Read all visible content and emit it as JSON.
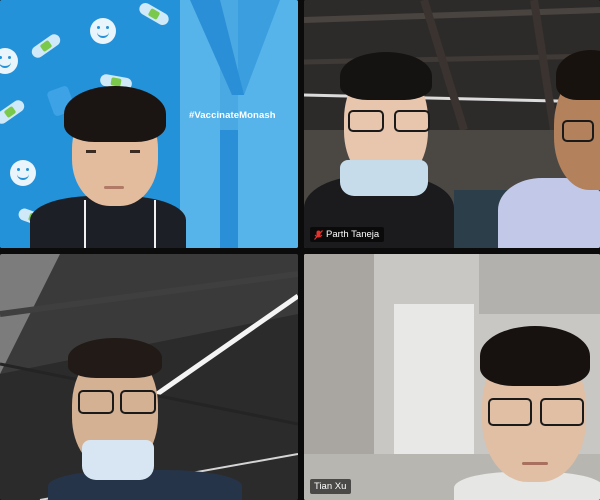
{
  "call": {
    "participants": [
      {
        "tile": 1,
        "name": "",
        "background_tag": "#VaccinateMonash",
        "label_visible": false
      },
      {
        "tile": 2,
        "name": "Parth Taneja",
        "label_visible": true,
        "muted": true
      },
      {
        "tile": 3,
        "name": "",
        "label_visible": false
      },
      {
        "tile": 4,
        "name": "Tian Xu",
        "label_visible": true,
        "muted": false
      }
    ]
  },
  "colors": {
    "brand_blue": "#2492d9",
    "panel_blue": "#56b4ea",
    "mute_red": "#e5322d"
  },
  "icons": {
    "mute": "mic-off-icon"
  }
}
